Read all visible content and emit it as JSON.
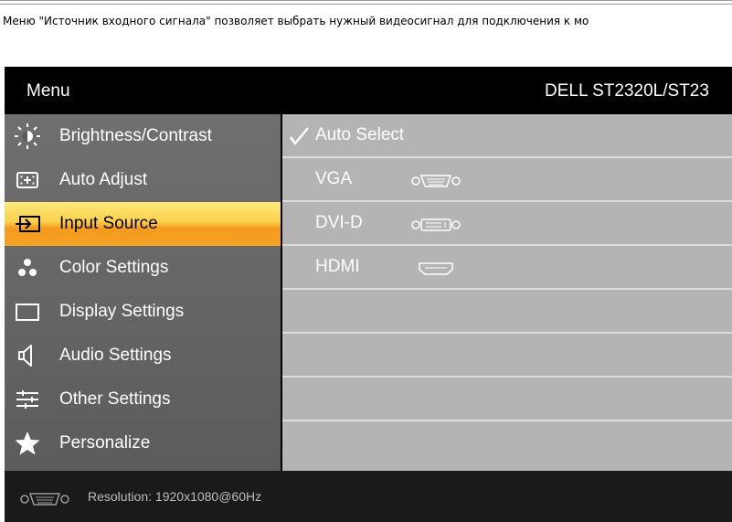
{
  "intro_text": "Меню \"Источник входного сигнала\" позволяет выбрать нужный видеосигнал для подключения к мо",
  "header": {
    "title": "Menu",
    "model": "DELL  ST2320L/ST23"
  },
  "menu_items": [
    {
      "label": "Brightness/Contrast",
      "icon": "brightness-icon"
    },
    {
      "label": "Auto Adjust",
      "icon": "auto-adjust-icon"
    },
    {
      "label": "Input Source",
      "icon": "input-source-icon",
      "selected": true
    },
    {
      "label": "Color Settings",
      "icon": "color-settings-icon"
    },
    {
      "label": "Display Settings",
      "icon": "display-settings-icon"
    },
    {
      "label": "Audio Settings",
      "icon": "speaker-icon"
    },
    {
      "label": "Other Settings",
      "icon": "sliders-icon"
    },
    {
      "label": "Personalize",
      "icon": "star-icon"
    }
  ],
  "options": [
    {
      "label": "Auto Select",
      "checked": true
    },
    {
      "label": "VGA",
      "icon": "vga-port-icon"
    },
    {
      "label": "DVI-D",
      "icon": "dvi-port-icon"
    },
    {
      "label": "HDMI",
      "icon": "hdmi-port-icon"
    }
  ],
  "footer": {
    "resolution": "Resolution:  1920x1080@60Hz",
    "icon": "vga-port-icon"
  },
  "colors": {
    "highlight_top": "#fde97a",
    "highlight_bottom": "#f59a1c",
    "left_panel": "#666666",
    "right_panel": "#b4b4b4"
  }
}
